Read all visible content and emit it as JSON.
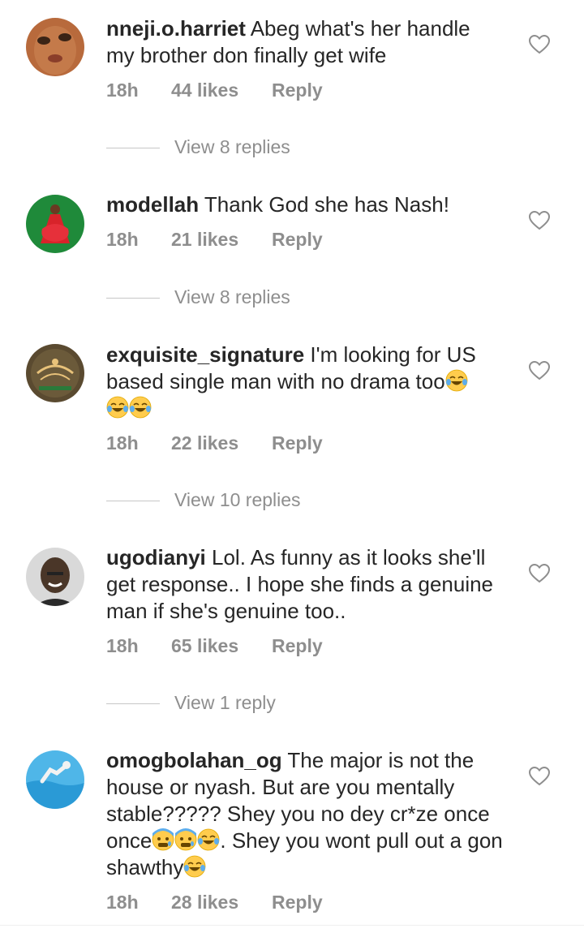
{
  "comments": [
    {
      "username": "nneji.o.harriet",
      "text": " Abeg what's her handle my brother don finally get wife",
      "time": "18h",
      "likes": "44 likes",
      "reply": "Reply",
      "view_replies": "View 8 replies",
      "avatar": "person-photo-icon"
    },
    {
      "username": "modellah",
      "text": " Thank God she has Nash!",
      "time": "18h",
      "likes": "21 likes",
      "reply": "Reply",
      "view_replies": "View 8 replies",
      "avatar": "person-in-red-dress-icon"
    },
    {
      "username": "exquisite_signature",
      "text": " I'm looking for US based single man with no drama too",
      "time": "18h",
      "likes": "22 likes",
      "reply": "Reply",
      "view_replies": "View 10 replies",
      "avatar": "brand-logo-icon"
    },
    {
      "username": "ugodianyi",
      "text": " Lol. As funny as it looks she'll get response.. I hope she finds a genuine man if she's genuine too..",
      "time": "18h",
      "likes": "65 likes",
      "reply": "Reply",
      "view_replies": "View 1 reply",
      "avatar": "smiling-man-icon"
    },
    {
      "username": "omogbolahan_og",
      "text_part1": " The major is not the house or nyash. But are you mentally stable????? Shey you no dey cr*ze once once",
      "text_part2": ". Shey you wont pull out a gon shawthy",
      "time": "18h",
      "likes": "28 likes",
      "reply": "Reply",
      "avatar": "swimmer-icon"
    }
  ],
  "colors": {
    "text": "#262626",
    "meta": "#8e8e8e",
    "divider": "#c7c7c7"
  }
}
